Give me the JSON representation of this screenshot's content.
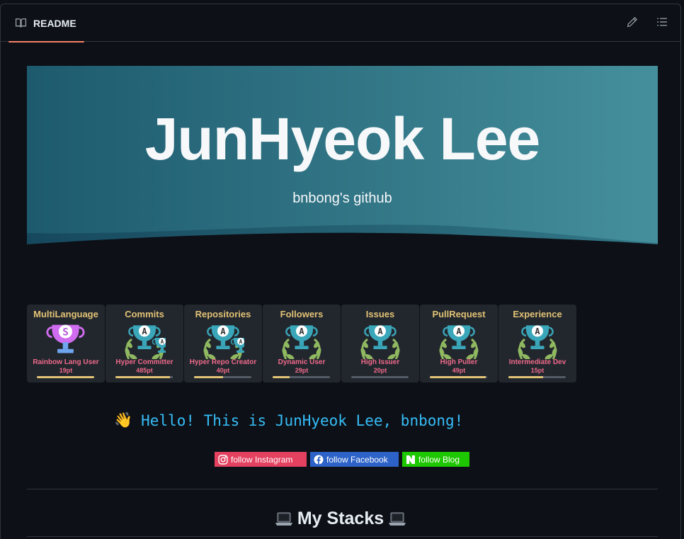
{
  "header": {
    "tab_label": "README",
    "icons": [
      "book-icon",
      "pencil-icon",
      "list-unordered-icon"
    ]
  },
  "banner": {
    "title": "JunHyeok Lee",
    "subtitle": "bnbong's github",
    "gradient": [
      "#1d5a6e",
      "#458f9c"
    ]
  },
  "trophies": [
    {
      "title": "MultiLanguage",
      "rank_letter": "S",
      "rank_title": "Rainbow Lang User",
      "points": "19pt",
      "progress": 1.0,
      "icon": "rainbow-trophy-icon",
      "double": false
    },
    {
      "title": "Commits",
      "rank_letter": "A",
      "rank_title": "Hyper Committer",
      "points": "485pt",
      "progress": 0.95,
      "icon": "trophy-icon",
      "double": true
    },
    {
      "title": "Repositories",
      "rank_letter": "A",
      "rank_title": "Hyper Repo Creator",
      "points": "40pt",
      "progress": 0.5,
      "icon": "trophy-icon",
      "double": true
    },
    {
      "title": "Followers",
      "rank_letter": "A",
      "rank_title": "Dynamic User",
      "points": "29pt",
      "progress": 0.3,
      "icon": "trophy-icon",
      "double": false
    },
    {
      "title": "Issues",
      "rank_letter": "A",
      "rank_title": "High Issuer",
      "points": "20pt",
      "progress": 0.0,
      "icon": "trophy-icon",
      "double": false
    },
    {
      "title": "PullRequest",
      "rank_letter": "A",
      "rank_title": "High Puller",
      "points": "49pt",
      "progress": 0.97,
      "icon": "trophy-icon",
      "double": false
    },
    {
      "title": "Experience",
      "rank_letter": "A",
      "rank_title": "Intermediate Dev",
      "points": "15pt",
      "progress": 0.6,
      "icon": "trophy-icon",
      "double": false
    }
  ],
  "hello": {
    "icon": "waving-hand-icon",
    "emoji": "👋",
    "text": "Hello! This is JunHyeok Lee, bnbong!"
  },
  "badges": [
    {
      "label": "follow Instagram",
      "icon": "instagram-icon"
    },
    {
      "label": "follow Facebook",
      "icon": "facebook-icon"
    },
    {
      "label": "follow Blog",
      "icon": "naver-icon"
    }
  ],
  "stacks": {
    "title": "My Stacks",
    "icon": "laptop-icon"
  }
}
